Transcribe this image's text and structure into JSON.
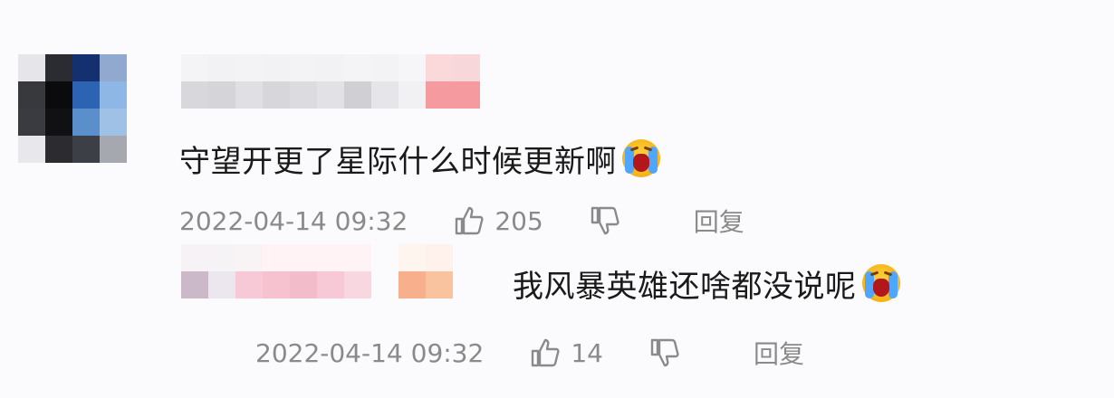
{
  "comments": [
    {
      "text": "守望开更了星际什么时候更新啊",
      "emoji": "crying-face",
      "date": "2022-04-14 09:32",
      "likes": "205",
      "reply_label": "回复"
    },
    {
      "text": "我风暴英雄还啥都没说呢",
      "emoji": "crying-face",
      "date": "2022-04-14 09:32",
      "likes": "14",
      "reply_label": "回复"
    }
  ],
  "colors": {
    "text": "#1a1a1a",
    "meta": "#8a8a8a",
    "background": "#fbfbfd"
  }
}
